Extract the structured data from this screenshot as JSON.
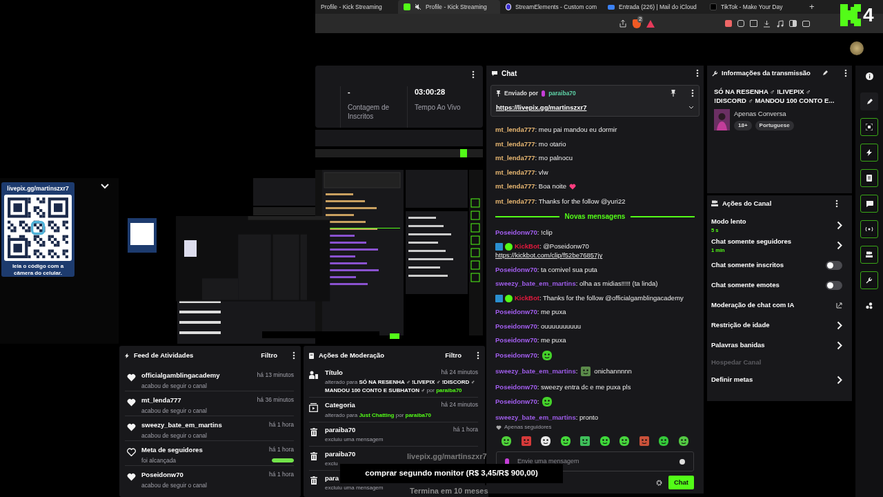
{
  "browser": {
    "tabs": [
      {
        "title": "Profile - Kick Streaming",
        "selected": false
      },
      {
        "title": "Profile - Kick Streaming",
        "selected": true
      },
      {
        "title": "StreamElements - Custom com",
        "selected": false
      },
      {
        "title": "Entrada (226) | Mail do iCloud",
        "selected": false
      },
      {
        "title": "TikTok - Make Your Day",
        "selected": false
      }
    ],
    "new_tab": "+",
    "shield_count": "2"
  },
  "logo": {
    "number": "4"
  },
  "stats": [
    {
      "value": "-",
      "label": "Contagem de Inscritos"
    },
    {
      "value": "03:00:28",
      "label": "Tempo Ao Vivo"
    }
  ],
  "qr": {
    "url": "livepix.gg/martinszxr7",
    "caption": "leia o código com a câmera do celular."
  },
  "chat": {
    "title": "Chat",
    "pinned": {
      "label": "Enviado por",
      "user": "paraiba70",
      "link": "https://livepix.gg/martinszxr7"
    },
    "messages": [
      {
        "kind": "text",
        "user": "mt_lenda777",
        "color": "#e9b872",
        "text": ": meu pai mandou eu dormir"
      },
      {
        "kind": "text",
        "user": "mt_lenda777",
        "color": "#e9b872",
        "text": ": mo otario"
      },
      {
        "kind": "text",
        "user": "mt_lenda777",
        "color": "#e9b872",
        "text": ": mo palnocu"
      },
      {
        "kind": "text",
        "user": "mt_lenda777",
        "color": "#e9b872",
        "text": ": vlw"
      },
      {
        "kind": "heart",
        "user": "mt_lenda777",
        "color": "#e9b872",
        "text": ": Boa noite"
      },
      {
        "kind": "text",
        "user": "mt_lenda777",
        "color": "#e9b872",
        "text": ": Thanks for the follow @yuri22"
      },
      {
        "kind": "divider",
        "text": "Novas mensagens"
      },
      {
        "kind": "text",
        "user": "Poseidonw70",
        "color": "#a35ef0",
        "text": ": !clip"
      },
      {
        "kind": "bot",
        "user": "KickBot",
        "color": "#e3193d",
        "text": ": @Poseidonw70",
        "link": "https://kickbot.com/clip/f52be76857jy"
      },
      {
        "kind": "text",
        "user": "Poseidonw70",
        "color": "#a35ef0",
        "text": ": ta comivel sua puta"
      },
      {
        "kind": "text",
        "user": "sweezy_bate_em_martins",
        "color": "#9d5ce8",
        "text": ": olha as midias!!!!! (ta linda)"
      },
      {
        "kind": "bot",
        "user": "KickBot",
        "color": "#e3193d",
        "text": ": Thanks for the follow @officialgamblingacademy"
      },
      {
        "kind": "text",
        "user": "Poseidonw70",
        "color": "#a35ef0",
        "text": ": me puxa"
      },
      {
        "kind": "text",
        "user": "Poseidonw70",
        "color": "#a35ef0",
        "text": ": ouuuuuuuuuu"
      },
      {
        "kind": "text",
        "user": "Poseidonw70",
        "color": "#a35ef0",
        "text": ": me puxa"
      },
      {
        "kind": "emote",
        "user": "Poseidonw70",
        "color": "#a35ef0",
        "text": ":"
      },
      {
        "kind": "emote",
        "user": "sweezy_bate_em_martins",
        "color": "#9d5ce8",
        "text": ":",
        "after": "onichannnnn"
      },
      {
        "kind": "text",
        "user": "Poseidonw70",
        "color": "#a35ef0",
        "text": ": sweezy entra dc e me puxa pls"
      },
      {
        "kind": "emote",
        "user": "Poseidonw70",
        "color": "#a35ef0",
        "text": ":"
      },
      {
        "kind": "text",
        "user": "sweezy_bate_em_martins",
        "color": "#9d5ce8",
        "text": ": pronto"
      }
    ],
    "mode": "Apenas seguidores",
    "placeholder": "Envie uma mensagem",
    "send": "Chat"
  },
  "stream_info": {
    "title": "Informações da transmissão",
    "stream_title": "SÓ NA RESENHA ♂ !LIVEPIX ♂ !DISCORD ♂ MANDOU 100 CONTO E...",
    "category": "Apenas Conversa",
    "tags": [
      "18+",
      "Portuguese"
    ]
  },
  "channel_actions": {
    "title": "Ações do Canal",
    "items": [
      {
        "kind": "nav",
        "label": "Modo lento",
        "sub": "5 s"
      },
      {
        "kind": "nav",
        "label": "Chat somente seguidores",
        "sub": "1 min"
      },
      {
        "kind": "toggle",
        "label": "Chat somente inscritos",
        "on": false
      },
      {
        "kind": "toggle",
        "label": "Chat somente emotes",
        "on": false
      },
      {
        "kind": "external",
        "label": "Moderação de chat com IA"
      },
      {
        "kind": "nav",
        "label": "Restrição de idade"
      },
      {
        "kind": "nav",
        "label": "Palavras banidas"
      },
      {
        "kind": "disabled",
        "label": "Hospedar Canal"
      },
      {
        "kind": "nav",
        "label": "Definir metas"
      }
    ]
  },
  "feed": {
    "title": "Feed de Atividades",
    "filter": "Filtro",
    "items": [
      {
        "kind": "follow",
        "name": "officialgamblingacademy",
        "desc": "acabou de seguir o canal",
        "time": "há 13 minutos"
      },
      {
        "kind": "follow",
        "name": "mt_lenda777",
        "desc": "acabou de seguir o canal",
        "time": "há 36 minutos"
      },
      {
        "kind": "follow",
        "name": "sweezy_bate_em_martins",
        "desc": "acabou de seguir o canal",
        "time": "há 1 hora"
      },
      {
        "kind": "goal",
        "name": "Meta de seguidores",
        "desc": "foi alcançada",
        "time": "há 1 hora",
        "level": 1
      },
      {
        "kind": "follow",
        "name": "Poseidonw70",
        "desc": "acabou de seguir o canal",
        "time": "há 1 hora"
      }
    ]
  },
  "moderation": {
    "title": "Ações de Moderação",
    "filter": "Filtro",
    "items": [
      {
        "kind": "title",
        "name": "Título",
        "time": "há 24 minutos",
        "parts": [
          {
            "kind": "plain",
            "text": "alterado para"
          },
          {
            "kind": "strong",
            "text": "SÓ NA RESENHA ♂ !LIVEPIX ♂ !DISCORD ♂ MANDOU 100 CONTO E SUBHATON ♂"
          },
          {
            "kind": "plain",
            "text": "por"
          },
          {
            "kind": "accent",
            "text": "paraiba70"
          }
        ]
      },
      {
        "kind": "category",
        "name": "Categoria",
        "time": "há 24 minutos",
        "parts": [
          {
            "kind": "plain",
            "text": "alterado para"
          },
          {
            "kind": "accent",
            "text": "Just Chatting"
          },
          {
            "kind": "plain",
            "text": "por"
          },
          {
            "kind": "accent",
            "text": "paraiba70"
          }
        ]
      },
      {
        "kind": "delete",
        "name": "paraiba70",
        "time": "há 1 hora",
        "parts": [
          {
            "kind": "plain",
            "text": "excluiu uma mensagem"
          }
        ]
      },
      {
        "kind": "delete",
        "name": "paraiba70",
        "parts": [
          {
            "kind": "plain",
            "text": "exclu"
          }
        ]
      },
      {
        "kind": "delete",
        "name": "para",
        "parts": [
          {
            "kind": "plain",
            "text": "excluiu uma mensagem"
          }
        ]
      }
    ]
  },
  "goal_overlay": {
    "url": "livepix.gg/martinszxr7",
    "goal": "comprar segundo monitor (R$ 3,45/R$ 900,00)",
    "ends": "Termina em 10 meses"
  }
}
